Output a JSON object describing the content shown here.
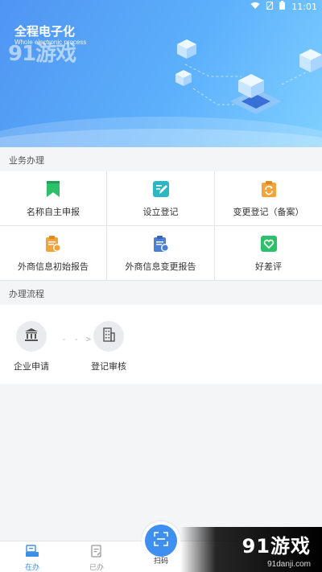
{
  "status_bar": {
    "time": "11:01"
  },
  "hero": {
    "title": "全程电子化",
    "subtitle": "Whole electronic process",
    "watermark": "91游戏"
  },
  "services": {
    "title": "业务办理",
    "items": [
      {
        "label": "名称自主申报",
        "icon": "bookmark-icon",
        "color": "#2ebf6a"
      },
      {
        "label": "设立登记",
        "icon": "edit-document-icon",
        "color": "#2bb8c4"
      },
      {
        "label": "变更登记（备案）",
        "icon": "refresh-clipboard-icon",
        "color": "#f2a33a"
      },
      {
        "label": "外商信息初始报告",
        "icon": "report-clipboard-icon",
        "color": "#f2a33a"
      },
      {
        "label": "外商信息变更报告",
        "icon": "percent-clipboard-icon",
        "color": "#4a7fd6"
      },
      {
        "label": "好差评",
        "icon": "rating-heart-icon",
        "color": "#2ebf6a"
      }
    ]
  },
  "process": {
    "title": "办理流程",
    "steps": [
      {
        "label": "企业申请",
        "icon": "bank-icon"
      },
      {
        "label": "登记审核",
        "icon": "building-icon"
      }
    ]
  },
  "tabbar": {
    "tabs": [
      {
        "label": "在办",
        "icon": "in-progress-icon",
        "active": true
      },
      {
        "label": "已办",
        "icon": "done-icon",
        "active": false
      }
    ],
    "scan_label": "扫码"
  },
  "watermark": {
    "brand": "91游戏",
    "site": "91danji.com"
  },
  "colors": {
    "accent": "#3f8ff0",
    "hero_start": "#4f95f2",
    "hero_end": "#7fd0ff"
  }
}
